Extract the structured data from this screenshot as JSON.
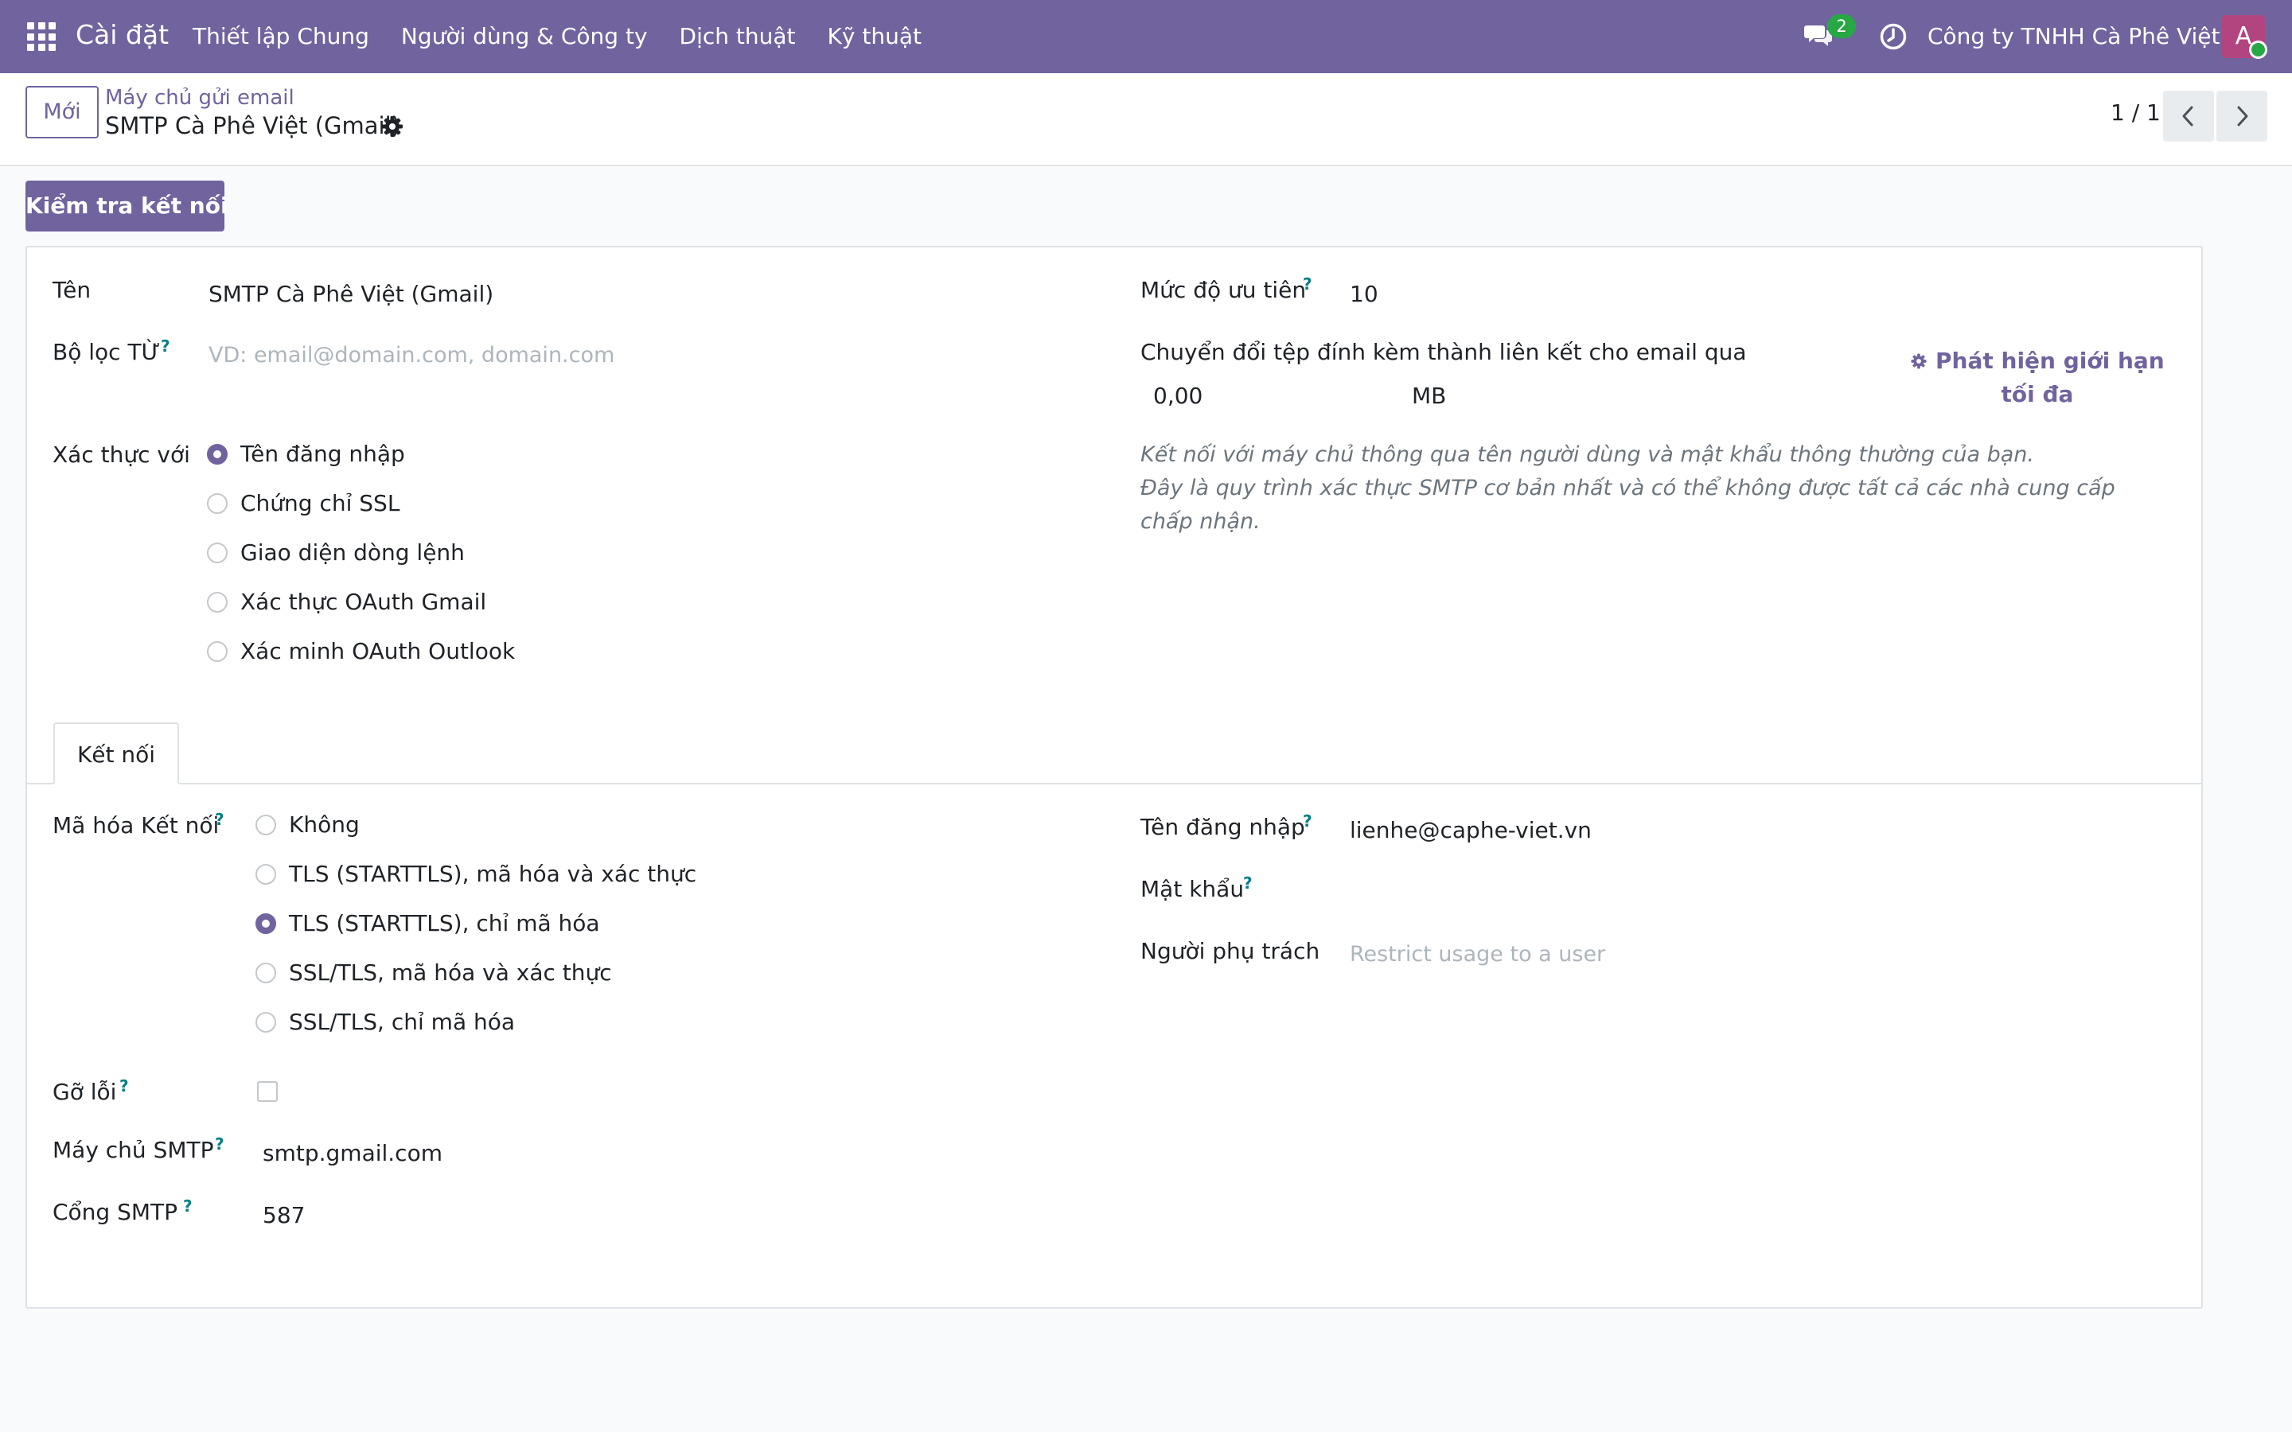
{
  "navbar": {
    "brand": "Cài đặt",
    "menu": [
      "Thiết lập Chung",
      "Người dùng & Công ty",
      "Dịch thuật",
      "Kỹ thuật"
    ],
    "messages_count": "2",
    "company": "Công ty TNHH Cà Phê Việt",
    "avatar_letter": "A"
  },
  "control_panel": {
    "new_button": "Mới",
    "breadcrumb_parent": "Máy chủ gửi email",
    "breadcrumb_current": "SMTP Cà Phê Việt (Gmail)",
    "pager": "1 / 1"
  },
  "actions": {
    "test_connection": "Kiểm tra kết nối"
  },
  "form": {
    "name_label": "Tên",
    "name_value": "SMTP Cà Phê Việt (Gmail)",
    "from_filter_label": "Bộ lọc TỪ",
    "from_filter_placeholder": "VD: email@domain.com, domain.com",
    "auth_label": "Xác thực với",
    "auth_options": [
      "Tên đăng nhập",
      "Chứng chỉ SSL",
      "Giao diện dòng lệnh",
      "Xác thực OAuth Gmail",
      "Xác minh OAuth Outlook"
    ],
    "auth_selected": 0,
    "priority_label": "Mức độ ưu tiên",
    "priority_value": "10",
    "attachment_label": "Chuyển đổi tệp đính kèm thành liên kết cho email qua",
    "attachment_value": "0,00",
    "attachment_unit": "MB",
    "detect_limit": "Phát hiện giới hạn tối đa",
    "auth_note_line1": "Kết nối với máy chủ thông qua tên người dùng và mật khẩu thông thường của bạn.",
    "auth_note_line2": "Đây là quy trình xác thực SMTP cơ bản nhất và có thể không được tất cả các nhà cung cấp chấp nhận."
  },
  "tabs": [
    "Kết nối"
  ],
  "connection": {
    "encryption_label": "Mã hóa Kết nối",
    "encryption_options": [
      "Không",
      "TLS (STARTTLS), mã hóa và xác thực",
      "TLS (STARTTLS), chỉ mã hóa",
      "SSL/TLS, mã hóa và xác thực",
      "SSL/TLS, chỉ mã hóa"
    ],
    "encryption_selected": 2,
    "debug_label": "Gỡ lỗi",
    "debug_checked": false,
    "smtp_server_label": "Máy chủ SMTP",
    "smtp_server_value": "smtp.gmail.com",
    "smtp_port_label": "Cổng SMTP",
    "smtp_port_value": "587",
    "username_label": "Tên đăng nhập",
    "username_value": "lienhe@caphe-viet.vn",
    "password_label": "Mật khẩu",
    "owner_label": "Người phụ trách",
    "owner_placeholder": "Restrict usage to a user"
  },
  "colors": {
    "brand": "#71639e",
    "success": "#28a745",
    "help": "#017e84"
  }
}
